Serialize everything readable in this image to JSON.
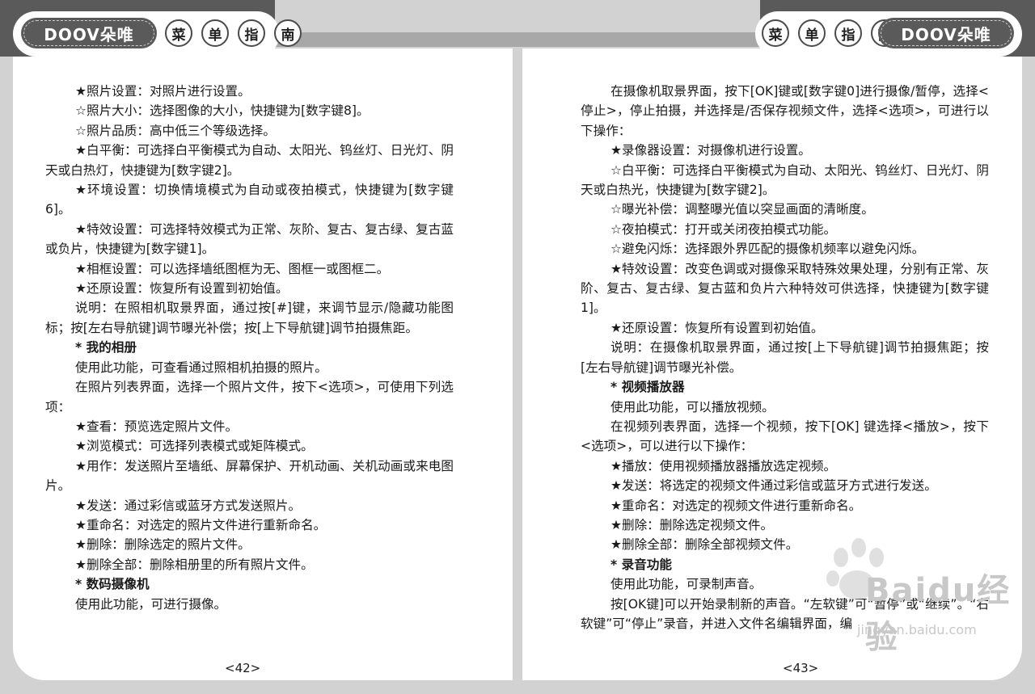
{
  "header": {
    "logo_left": "DOOV朵唯",
    "logo_right": "DOOV朵唯",
    "title_chars": [
      "菜",
      "单",
      "指",
      "南"
    ]
  },
  "left_page": {
    "paragraphs": [
      {
        "text": "★照片设置：对照片进行设置。",
        "heading": false
      },
      {
        "text": "☆照片大小：选择图像的大小，快捷键为[数字键8]。",
        "heading": false
      },
      {
        "text": "☆照片品质：高中低三个等级选择。",
        "heading": false
      },
      {
        "text": "★白平衡：可选择白平衡模式为自动、太阳光、钨丝灯、日光灯、阴天或白热灯，快捷键为[数字键2]。",
        "heading": false
      },
      {
        "text": "★环境设置：切换情境模式为自动或夜拍模式，快捷键为[数字键6]。",
        "heading": false
      },
      {
        "text": "★特效设置：可选择特效模式为正常、灰阶、复古、复古绿、复古蓝或负片，快捷键为[数字键1]。",
        "heading": false
      },
      {
        "text": "★相框设置：可以选择墙纸图框为无、图框一或图框二。",
        "heading": false
      },
      {
        "text": "★还原设置：恢复所有设置到初始值。",
        "heading": false
      },
      {
        "text": "说明：在照相机取景界面，通过按[#]键，来调节显示/隐藏功能图标；按[左右导航键]调节曝光补偿；按[上下导航键]调节拍摄焦距。",
        "heading": false
      },
      {
        "text": "* 我的相册",
        "heading": true
      },
      {
        "text": "使用此功能，可查看通过照相机拍摄的照片。",
        "heading": false
      },
      {
        "text": "在照片列表界面，选择一个照片文件，按下<选项>，可使用下列选项：",
        "heading": false
      },
      {
        "text": "★查看：预览选定照片文件。",
        "heading": false
      },
      {
        "text": "★浏览模式：可选择列表模式或矩阵模式。",
        "heading": false
      },
      {
        "text": "★用作：发送照片至墙纸、屏幕保护、开机动画、关机动画或来电图片。",
        "heading": false
      },
      {
        "text": "★发送：通过彩信或蓝牙方式发送照片。",
        "heading": false
      },
      {
        "text": "★重命名：对选定的照片文件进行重新命名。",
        "heading": false
      },
      {
        "text": "★删除：删除选定的照片文件。",
        "heading": false
      },
      {
        "text": "★删除全部：删除相册里的所有照片文件。",
        "heading": false
      },
      {
        "text": "* 数码摄像机",
        "heading": true
      },
      {
        "text": "使用此功能，可进行摄像。",
        "heading": false
      }
    ],
    "page_number": "<42>"
  },
  "right_page": {
    "paragraphs": [
      {
        "text": "在摄像机取景界面，按下[OK]键或[数字键0]进行摄像/暂停，选择<停止>，停止拍摄，并选择是/否保存视频文件，选择<选项>，可进行以下操作：",
        "heading": false
      },
      {
        "text": "★录像器设置：对摄像机进行设置。",
        "heading": false
      },
      {
        "text": "☆白平衡：可选择白平衡模式为自动、太阳光、钨丝灯、日光灯、阴天或白热光，快捷键为[数字键2]。",
        "heading": false
      },
      {
        "text": "☆曝光补偿：调整曝光值以突显画面的清晰度。",
        "heading": false
      },
      {
        "text": "☆夜拍模式：打开或关闭夜拍模式功能。",
        "heading": false
      },
      {
        "text": "☆避免闪烁：选择跟外界匹配的摄像机频率以避免闪烁。",
        "heading": false
      },
      {
        "text": "★特效设置：改变色调或对摄像采取特殊效果处理，分别有正常、灰阶、复古、复古绿、复古蓝和负片六种特效可供选择，快捷键为[数字键1]。",
        "heading": false
      },
      {
        "text": "★还原设置：恢复所有设置到初始值。",
        "heading": false
      },
      {
        "text": "说明：在摄像机取景界面，通过按[上下导航键]调节拍摄焦距；按[左右导航键]调节曝光补偿。",
        "heading": false
      },
      {
        "text": "* 视频播放器",
        "heading": true
      },
      {
        "text": "使用此功能，可以播放视频。",
        "heading": false
      },
      {
        "text": "在视频列表界面，选择一个视频，按下[OK] 键选择<播放>，按下<选项>，可以进行以下操作：",
        "heading": false
      },
      {
        "text": "★播放：使用视频播放器播放选定视频。",
        "heading": false
      },
      {
        "text": "★发送：将选定的视频文件通过彩信或蓝牙方式进行发送。",
        "heading": false
      },
      {
        "text": "★重命名：对选定的视频文件进行重新命名。",
        "heading": false
      },
      {
        "text": "★删除：删除选定视频文件。",
        "heading": false
      },
      {
        "text": "★删除全部：删除全部视频文件。",
        "heading": false
      },
      {
        "text": "* 录音功能",
        "heading": true
      },
      {
        "text": "使用此功能，可录制声音。",
        "heading": false
      },
      {
        "text": "按[OK键]可以开始录制新的声音。“左软键”可“暂停”或“继续”。“右软键”可“停止”录音，并进入文件名编辑界面，编",
        "heading": false
      }
    ],
    "page_number": "<43>"
  },
  "watermark": {
    "text": "Baidu经验",
    "sub": "jingyan.baidu.com"
  }
}
